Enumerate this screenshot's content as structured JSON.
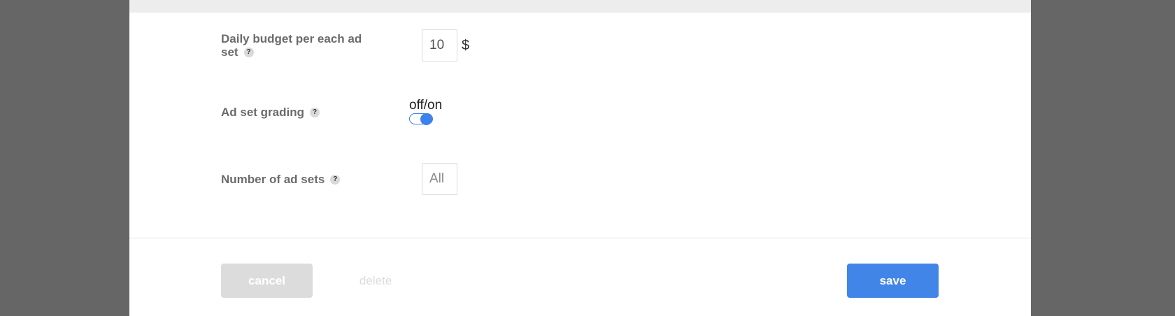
{
  "form": {
    "daily_budget": {
      "label": "Daily budget per each ad set",
      "label_line1": "Daily budget per each ad",
      "label_line2": "set",
      "help": "?",
      "value": "10",
      "currency": "$"
    },
    "ad_set_grading": {
      "label": "Ad set grading",
      "help": "?",
      "toggle_caption": "off/on",
      "enabled": true
    },
    "number_of_ad_sets": {
      "label": "Number of ad sets",
      "help": "?",
      "placeholder": "All"
    }
  },
  "footer": {
    "cancel_label": "cancel",
    "delete_label": "delete",
    "save_label": "save"
  },
  "colors": {
    "overlay": "#666666",
    "accent": "#4285e8",
    "disabled": "#dcdcdc"
  }
}
